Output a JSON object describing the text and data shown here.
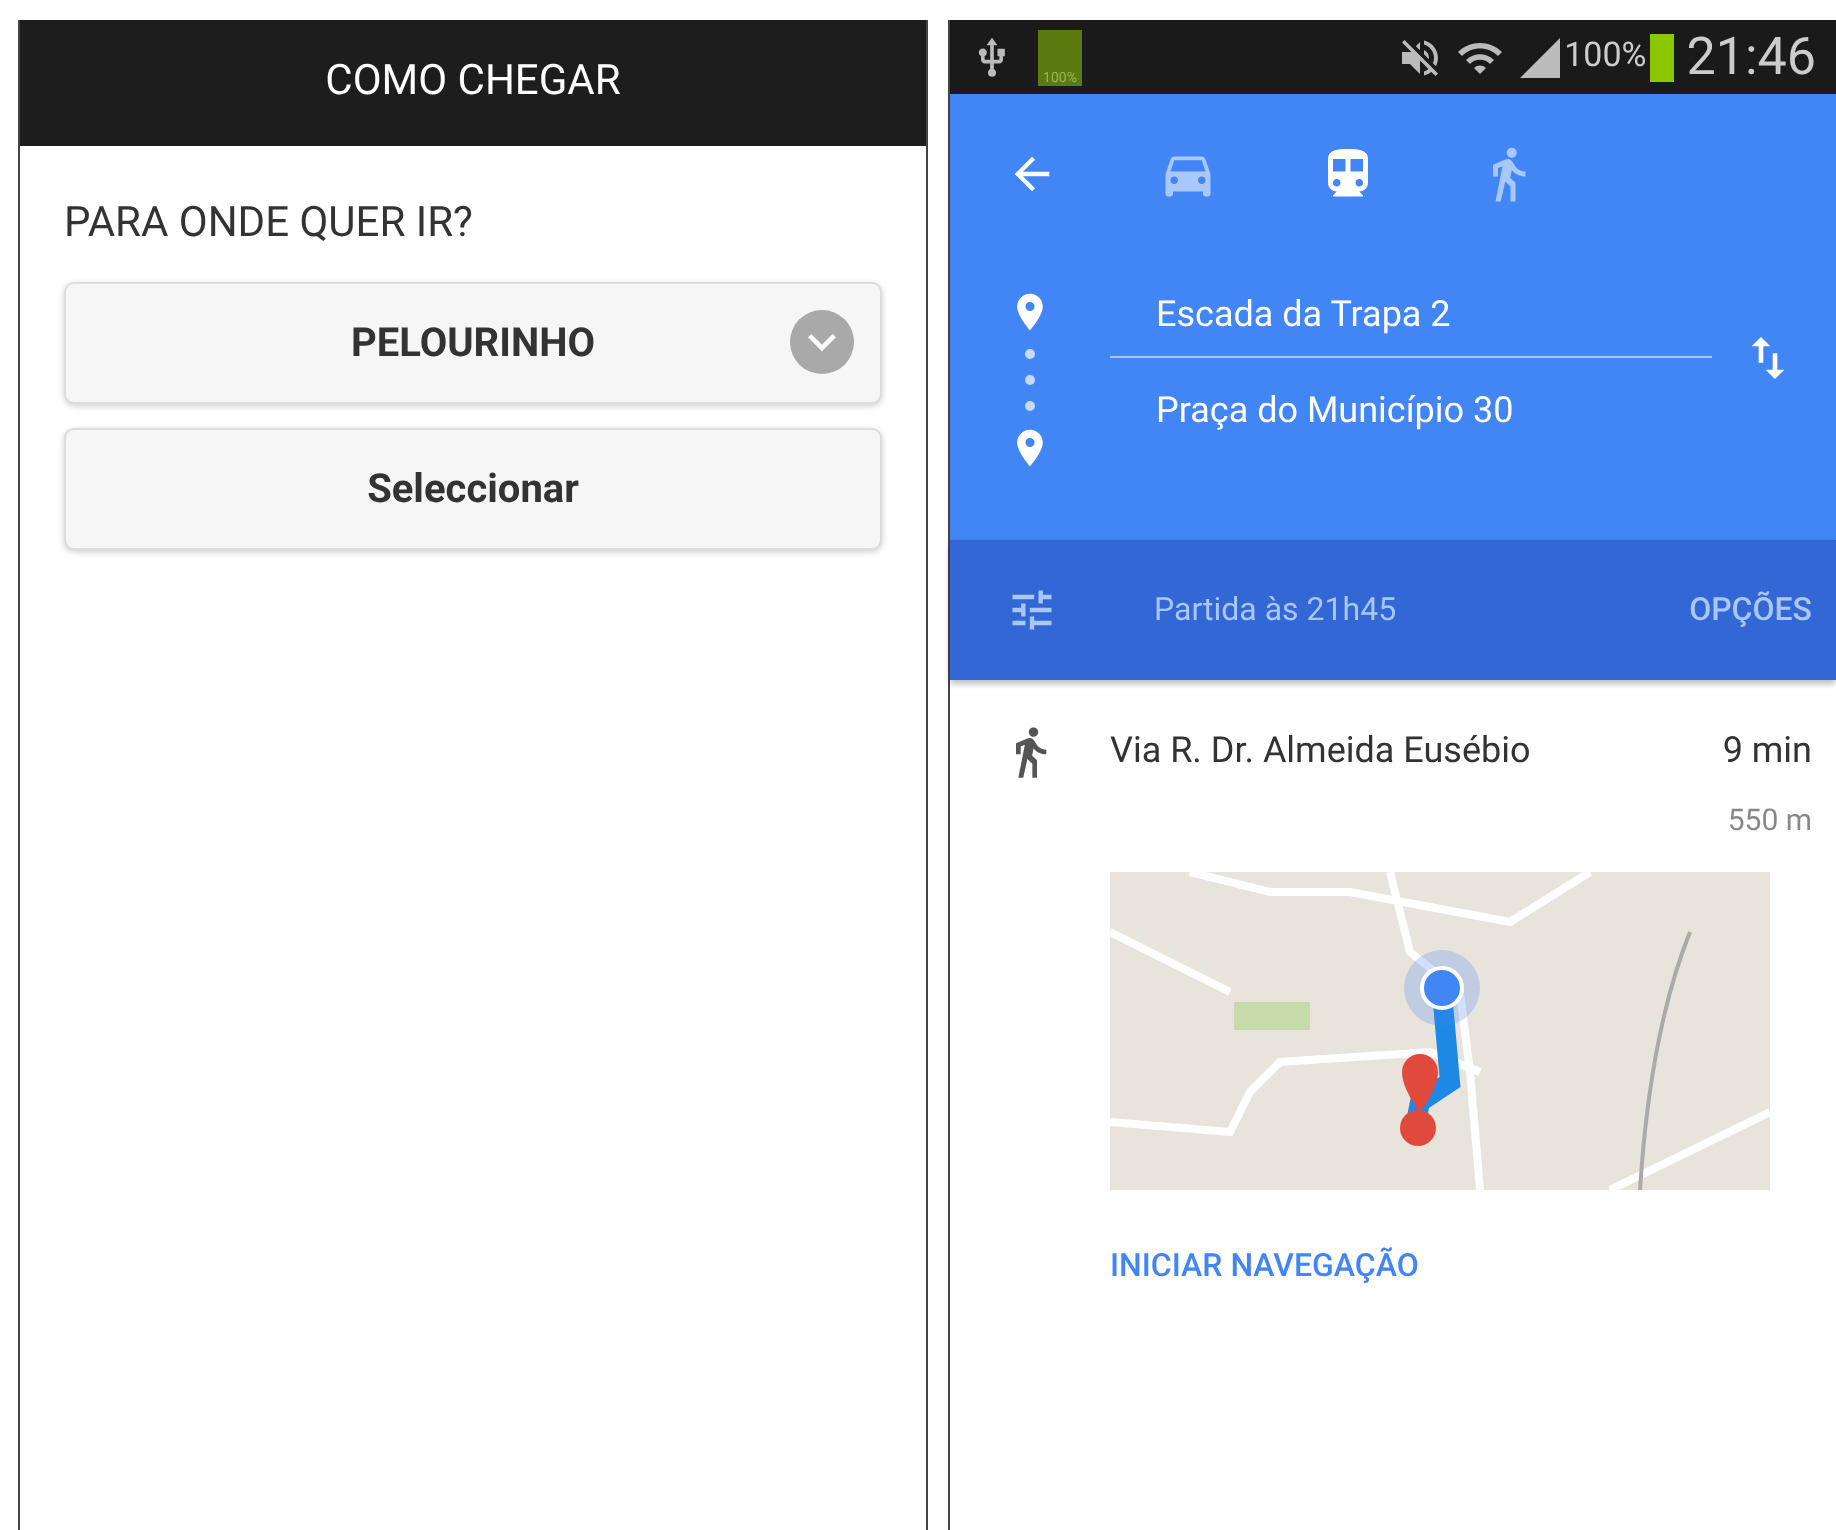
{
  "left": {
    "title": "COMO CHEGAR",
    "question": "PARA ONDE QUER IR?",
    "select": {
      "value": "PELOURINHO"
    },
    "button": "Seleccionar"
  },
  "right": {
    "status_bar": {
      "charge_label": "100%",
      "battery": "100%",
      "time": "21:46"
    },
    "modes": [
      {
        "kind": "car",
        "selected": false
      },
      {
        "kind": "train",
        "selected": true
      },
      {
        "kind": "walk",
        "selected": false
      }
    ],
    "origin": "Escada da Trapa 2",
    "destination": "Praça do Município 30",
    "departure": "Partida às 21h45",
    "options": "OPÇÕES",
    "step": {
      "kind": "walk",
      "text": "Via R. Dr. Almeida Eusébio",
      "duration": "9 min",
      "distance": "550 m"
    },
    "navigate": "INICIAR NAVEGAÇÃO"
  }
}
